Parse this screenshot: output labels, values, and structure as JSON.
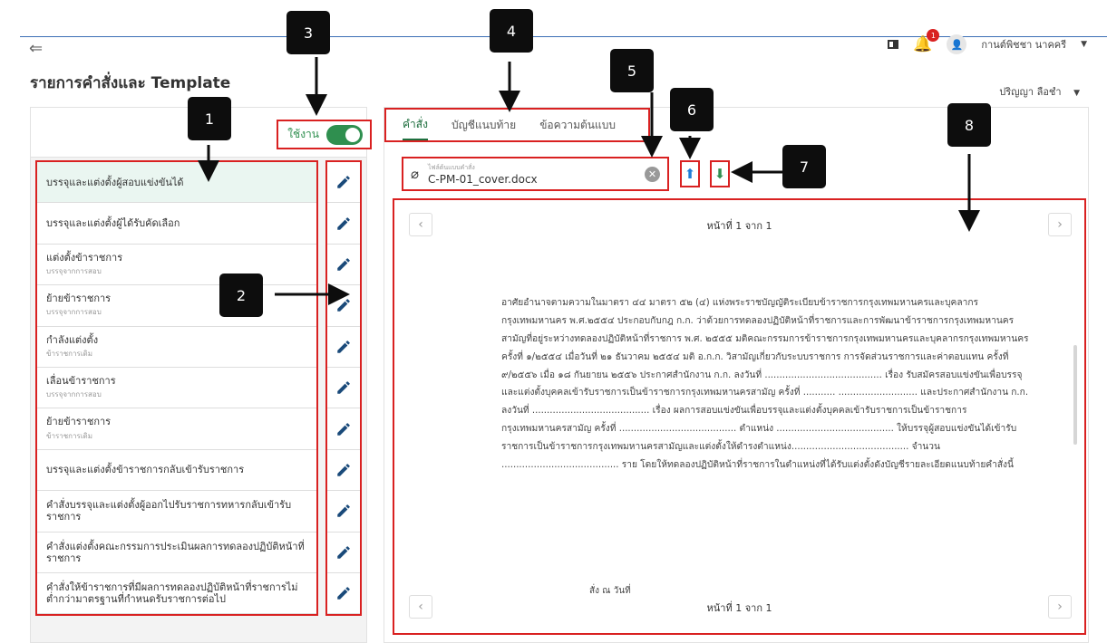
{
  "header": {
    "back_icon": "arrow-left-icon",
    "title": "รายการคำสั่งและ Template",
    "notification_count": "1",
    "user_name": "กานต์พิชชา นาคครี",
    "sub_user_name": "ปริญญา ลือชำ"
  },
  "left_panel": {
    "toggle_label": "ใช้งาน",
    "toggle_on": true,
    "items": [
      {
        "label": "บรรจุและแต่งตั้งผู้สอบแข่งขันได้",
        "sub": ""
      },
      {
        "label": "บรรจุและแต่งตั้งผู้ได้รับคัดเลือก",
        "sub": ""
      },
      {
        "label": "แต่งตั้งข้าราชการ",
        "sub": "บรรจุจากการสอบ"
      },
      {
        "label": "ย้ายข้าราชการ",
        "sub": "บรรจุจากการสอบ"
      },
      {
        "label": "กำลังแต่งตั้ง",
        "sub": "ข้าราชการเดิม"
      },
      {
        "label": "เลื่อนข้าราชการ",
        "sub": "บรรจุจากการสอบ"
      },
      {
        "label": "ย้ายข้าราชการ",
        "sub": "ข้าราชการเดิม"
      },
      {
        "label": "บรรจุและแต่งตั้งข้าราชการกลับเข้ารับราชการ",
        "sub": ""
      },
      {
        "label": "คำสั่งบรรจุและแต่งตั้งผู้ออกไปรับราชการทหารกลับเข้ารับราชการ",
        "sub": ""
      },
      {
        "label": "คำสั่งแต่งตั้งคณะกรรมการประเมินผลการทดลองปฏิบัติหน้าที่ราชการ",
        "sub": ""
      },
      {
        "label": "คำสั่งให้ข้าราชการที่มีผลการทดลองปฏิบัติหน้าที่ราชการไม่ต่ำกว่ามาตรฐานที่กำหนดรับราชการต่อไป",
        "sub": ""
      }
    ]
  },
  "right_panel": {
    "tabs": [
      {
        "label": "คำสั่ง",
        "active": true
      },
      {
        "label": "บัญชีแนบท้าย",
        "active": false
      },
      {
        "label": "ข้อความต้นแบบ",
        "active": false
      }
    ],
    "file_caption": "ไฟล์ต้นแบบคำสั่ง",
    "file_name": "C-PM-01_cover.docx",
    "page_indicator": "หน้าที่ 1 จาก 1",
    "document_text": "อาศัยอำนาจตามความในมาตรา ๔๔ มาตรา ๕๒ (๔) แห่งพระราชบัญญัติระเบียบข้าราชการกรุงเทพมหานครและบุคลากรกรุงเทพมหานคร พ.ศ.๒๕๕๔ ประกอบกับกฎ ก.ก. ว่าด้วยการทดลองปฏิบัติหน้าที่ราชการและการพัฒนาข้าราชการกรุงเทพมหานครสามัญที่อยู่ระหว่างทดลองปฏิบัติหน้าที่ราชการ พ.ศ. ๒๕๕๕ มติคณะกรรมการข้าราชการกรุงเทพมหานครและบุคลากรกรุงเทพมหานคร ครั้งที่ ๑/๒๕๕๔ เมื่อวันที่ ๒๑ ธันวาคม ๒๕๕๔ มติ อ.ก.ก. วิสามัญเกี่ยวกับระบบราชการ การจัดส่วนราชการและค่าตอบแทน ครั้งที่ ๙/๒๕๕๖ เมื่อ ๑๘ กันยายน ๒๕๕๖ ประกาศสำนักงาน ก.ก. ลงวันที่ ........................................ เรื่อง รับสมัครสอบแข่งขันเพื่อบรรจุและแต่งตั้งบุคคลเข้ารับราชการเป็นข้าราชการกรุงเทพมหานครสามัญ ครั้งที่ ........... ........................... และประกาศสำนักงาน ก.ก. ลงวันที่ ........................................ เรื่อง ผลการสอบแข่งขันเพื่อบรรจุและแต่งตั้งบุคคลเข้ารับราชการเป็นข้าราชการกรุงเทพมหานครสามัญ ครั้งที่ ........................................ ตำแหน่ง ........................................ ให้บรรจุผู้สอบแข่งขันได้เข้ารับราชการเป็นข้าราชการกรุงเทพมหานครสามัญและแต่งตั้งให้ดำรงตำแหน่ง........................................ จำนวน ........................................ ราย โดยให้ทดลองปฏิบัติหน้าที่ราชการในตำแหน่งที่ได้รับแต่งตั้งดังบัญชีรายละเอียดแนบท้ายคำสั่งนี้",
    "document_signature": "สั่ง ณ วันที่"
  },
  "callouts": [
    "1",
    "2",
    "3",
    "4",
    "5",
    "6",
    "7",
    "8"
  ],
  "colors": {
    "accent": "#2f8f4f",
    "highlight": "#d92121",
    "upload": "#1e7ed8",
    "callout": "#0d0d0d"
  }
}
